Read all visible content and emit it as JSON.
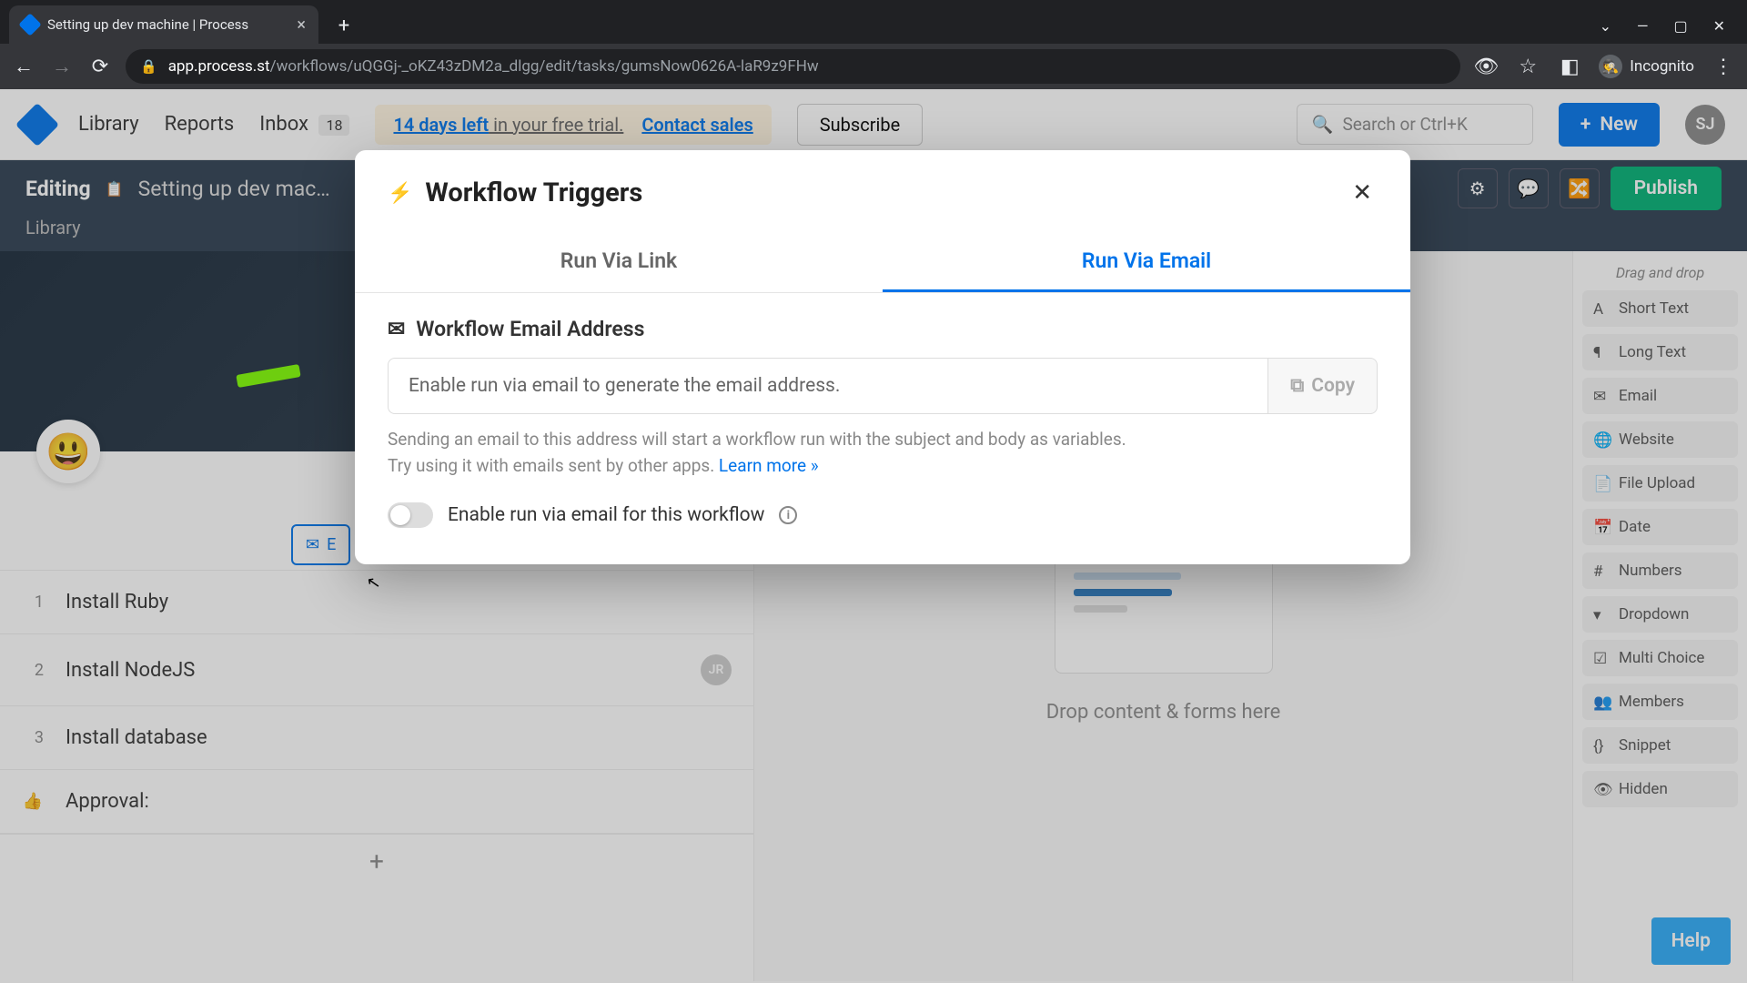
{
  "browser": {
    "tab_title": "Setting up dev machine | Process",
    "url_domain": "app.process.st",
    "url_path": "/workflows/uQGGj-_oKZ43zDM2a_dlgg/edit/tasks/gumsNow0626A-laR9z9FHw",
    "incognito_label": "Incognito"
  },
  "header": {
    "nav": {
      "library": "Library",
      "reports": "Reports",
      "inbox": "Inbox",
      "inbox_count": "18"
    },
    "trial_days": "14 days left",
    "trial_rest": " in your free trial.",
    "contact_sales": "Contact sales",
    "subscribe": "Subscribe",
    "search_placeholder": "Search or Ctrl+K",
    "new_button": "New",
    "avatar_initials": "SJ"
  },
  "editing": {
    "label": "Editing",
    "workflow_name": "Setting up dev mac…",
    "breadcrumb": "Library",
    "publish": "Publish"
  },
  "tasks": [
    {
      "num": "1",
      "name": "Install Ruby"
    },
    {
      "num": "2",
      "name": "Install NodeJS",
      "avatar": "JR"
    },
    {
      "num": "3",
      "name": "Install database"
    },
    {
      "name": "Approval:",
      "approval": true
    }
  ],
  "partial_button_char": "E",
  "center": {
    "drop_text": "Drop content & forms here"
  },
  "sidebar": {
    "dd_label": "Drag and drop",
    "fields": [
      "Short Text",
      "Long Text",
      "Email",
      "Website",
      "File Upload",
      "Date",
      "Numbers",
      "Dropdown",
      "Multi Choice",
      "Members",
      "Snippet",
      "Hidden"
    ]
  },
  "modal": {
    "title": "Workflow Triggers",
    "tabs": {
      "link": "Run Via Link",
      "email": "Run Via Email"
    },
    "section": "Workflow Email Address",
    "email_placeholder": "Enable run via email to generate the email address.",
    "copy_label": "Copy",
    "help1": "Sending an email to this address will start a workflow run with the subject and body as variables.",
    "help2a": "Try using it with emails sent by other apps. ",
    "help2b": "Learn more »",
    "toggle_label": "Enable run via email for this workflow"
  },
  "help_fab": "Help"
}
